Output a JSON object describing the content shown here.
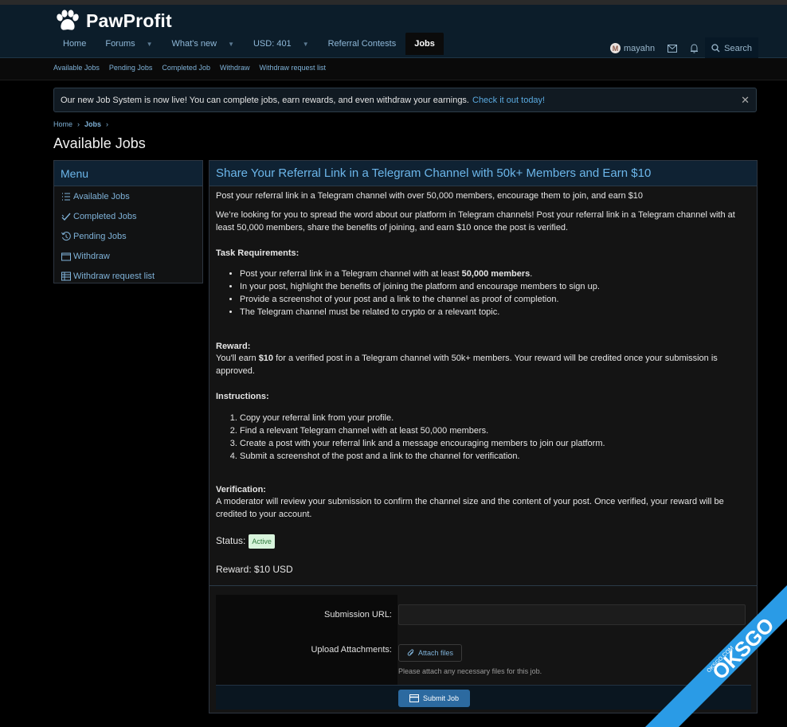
{
  "site": {
    "name": "PawProfit"
  },
  "nav": {
    "items": [
      {
        "label": "Home"
      },
      {
        "label": "Forums"
      },
      {
        "label": "What's new"
      },
      {
        "label": "USD: 401"
      },
      {
        "label": "Referral Contests"
      },
      {
        "label": "Jobs"
      }
    ]
  },
  "user": {
    "avatar_letter": "M",
    "name": "mayahn",
    "search_label": "Search"
  },
  "subnav": [
    "Available Jobs",
    "Pending Jobs",
    "Completed Job",
    "Withdraw",
    "Withdraw request list"
  ],
  "notice": {
    "text": "Our new Job System is now live! You can complete jobs, earn rewards, and even withdraw your earnings.",
    "link": "Check it out today!"
  },
  "breadcrumb": [
    "Home",
    "Jobs"
  ],
  "page_title": "Available Jobs",
  "sidebar": {
    "title": "Menu",
    "items": [
      {
        "label": "Available Jobs",
        "icon": "list-icon"
      },
      {
        "label": "Completed Jobs",
        "icon": "check-icon"
      },
      {
        "label": "Pending Jobs",
        "icon": "history-icon"
      },
      {
        "label": "Withdraw",
        "icon": "wallet-icon"
      },
      {
        "label": "Withdraw request list",
        "icon": "table-icon"
      }
    ]
  },
  "job": {
    "title": "Share Your Referral Link in a Telegram Channel with 50k+ Members and Earn $10",
    "summary": "Post your referral link in a Telegram channel with over 50,000 members, encourage them to join, and earn $10",
    "intro": "We’re looking for you to spread the word about our platform in Telegram channels! Post your referral link in a Telegram channel with at least 50,000 members, share the benefits of joining, and earn $10 once the post is verified.",
    "requirements_title": "Task Requirements:",
    "req1_pre": "Post your referral link in a Telegram channel with at least ",
    "req1_bold": "50,000 members",
    "req1_post": ".",
    "req2": "In your post, highlight the benefits of joining the platform and encourage members to sign up.",
    "req3": "Provide a screenshot of your post and a link to the channel as proof of completion.",
    "req4": "The Telegram channel must be related to crypto or a relevant topic.",
    "reward_title": "Reward:",
    "reward_pre": "You'll earn ",
    "reward_bold": "$10",
    "reward_post": " for a verified post in a Telegram channel with 50k+ members. Your reward will be credited once your submission is approved.",
    "instructions_title": "Instructions:",
    "ins1": "Copy your referral link from your profile.",
    "ins2": "Find a relevant Telegram channel with at least 50,000 members.",
    "ins3": "Create a post with your referral link and a message encouraging members to join our platform.",
    "ins4": "Submit a screenshot of the post and a link to the channel for verification.",
    "verification_title": "Verification:",
    "verification_text": "A moderator will review your submission to confirm the channel size and the content of your post. Once verified, your reward will be credited to your account.",
    "status_label": "Status:",
    "status_value": "Active",
    "reward_line": "Reward: $10 USD"
  },
  "form": {
    "url_label": "Submission URL:",
    "url_value": "",
    "attach_label": "Upload Attachments:",
    "attach_button": "Attach files",
    "attach_hint": "Please attach any necessary files for this job.",
    "submit_label": "Submit Job"
  },
  "watermark": {
    "text": "OKSGO",
    "small": "OKSGO.COM"
  }
}
